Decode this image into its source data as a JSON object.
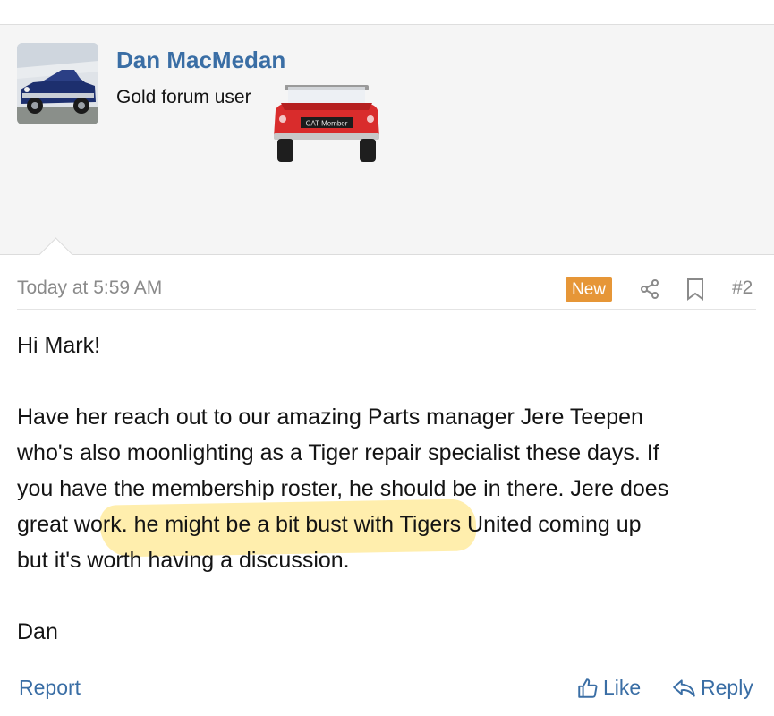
{
  "colors": {
    "link": "#3a6ea5",
    "badge_new": "#e69637",
    "highlight": "#ffd63c",
    "meta_text": "#8a8a8a"
  },
  "user": {
    "name": "Dan MacMedan",
    "title": "Gold forum user",
    "banner_plate": "CAT Member"
  },
  "post": {
    "date": "Today at 5:59 AM",
    "badge": "New",
    "number": "#2",
    "lines": [
      "Hi Mark!",
      "Have her reach out to our amazing Parts manager Jere Teepen",
      "who's also moonlighting as a Tiger repair specialist these days. If",
      "you have the membership roster, he should be in there. Jere does",
      "great work. he might be a bit bust with Tigers United coming up",
      "but it's worth having a discussion.",
      "Dan"
    ]
  },
  "actions": {
    "report": "Report",
    "like": "Like",
    "reply": "Reply"
  },
  "icons": [
    "share-icon",
    "bookmark-icon",
    "thumbs-up-icon",
    "reply-arrow-icon"
  ]
}
